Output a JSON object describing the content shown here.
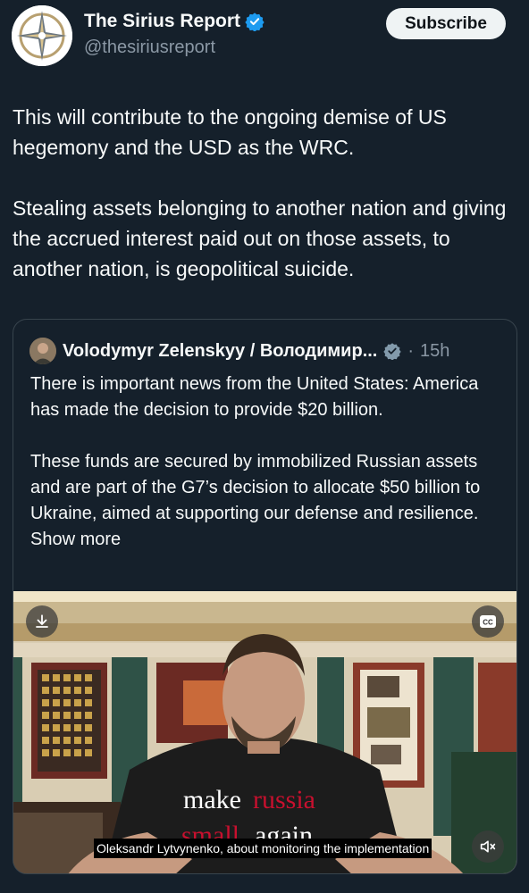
{
  "header": {
    "display_name": "The Sirius Report",
    "handle": "@thesiriusreport",
    "subscribe_label": "Subscribe"
  },
  "tweet": {
    "paragraph_1": "This will contribute to the ongoing demise of US hegemony and the USD as the WRC.",
    "paragraph_2": "Stealing assets belonging to another nation and giving the accrued interest paid out on those assets, to another nation, is geopolitical suicide."
  },
  "quote": {
    "author": "Volodymyr Zelenskyy / Володимир...",
    "time": "15h",
    "dot": "·",
    "paragraph_1": "There is important news from the United States: America has made the decision to provide $20 billion.",
    "paragraph_2": "These funds are secured by immobilized Russian assets and are part of the G7’s decision to allocate $50 billion to Ukraine, aimed at supporting our defense and resilience.",
    "show_more": "Show more",
    "video": {
      "caption": "Oleksandr Lytvynenko, about monitoring the implementation",
      "shirt_line_1_a": "make",
      "shirt_line_1_b": "russia",
      "shirt_line_2_a": "small",
      "shirt_line_2_b": "again",
      "cc_label": "CC"
    }
  },
  "colors": {
    "background": "#15202b",
    "text_primary": "#f7f9f9",
    "text_secondary": "#8b98a5",
    "verified": "#1d9bf0",
    "border": "#38444d",
    "subscribe_bg": "#eff3f4"
  },
  "icons": {
    "verified": "verified-badge-icon",
    "download": "download-icon",
    "captions": "closed-captions-icon",
    "mute": "volume-muted-icon"
  }
}
